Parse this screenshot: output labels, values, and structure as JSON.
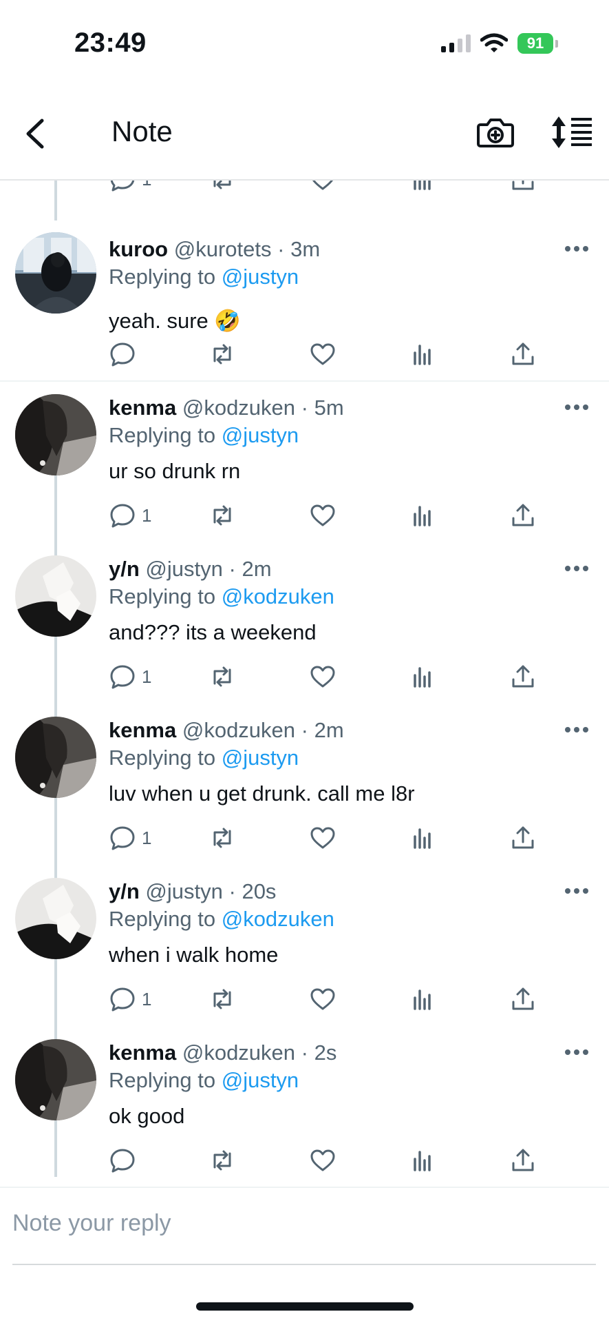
{
  "status_bar": {
    "time": "23:49",
    "battery": "91",
    "icons": [
      "signal-icon",
      "wifi-icon",
      "battery-icon"
    ]
  },
  "header": {
    "title": "Note",
    "icons": [
      "back-icon",
      "camera-icon",
      "sort-icon"
    ]
  },
  "colors": {
    "accent": "#1d9bf0",
    "text": "#0f1419",
    "secondary": "#536471",
    "battery": "#34c759"
  },
  "top_actions": {
    "reply_count": "1"
  },
  "tweets": [
    {
      "name": "kuroo",
      "handle": "@kurotets",
      "dot": "·",
      "time": "3m",
      "replying_prefix": "Replying to",
      "replying_to": "@justyn",
      "text": "yeah. sure 🤣",
      "reply_count": ""
    },
    {
      "name": "kenma",
      "handle": "@kodzuken",
      "dot": "·",
      "time": "5m",
      "replying_prefix": "Replying to",
      "replying_to": "@justyn",
      "text": "ur so drunk rn",
      "reply_count": "1"
    },
    {
      "name": "y/n",
      "handle": "@justyn",
      "dot": "·",
      "time": "2m",
      "replying_prefix": "Replying to",
      "replying_to": "@kodzuken",
      "text": "and??? its a weekend",
      "reply_count": "1"
    },
    {
      "name": "kenma",
      "handle": "@kodzuken",
      "dot": "·",
      "time": "2m",
      "replying_prefix": "Replying to",
      "replying_to": "@justyn",
      "text": "luv when u get drunk. call me l8r",
      "reply_count": "1"
    },
    {
      "name": "y/n",
      "handle": "@justyn",
      "dot": "·",
      "time": "20s",
      "replying_prefix": "Replying to",
      "replying_to": "@kodzuken",
      "text": "when i walk home",
      "reply_count": "1"
    },
    {
      "name": "kenma",
      "handle": "@kodzuken",
      "dot": "·",
      "time": "2s",
      "replying_prefix": "Replying to",
      "replying_to": "@justyn",
      "text": "ok good",
      "reply_count": ""
    }
  ],
  "compose": {
    "placeholder": "Note your reply"
  }
}
